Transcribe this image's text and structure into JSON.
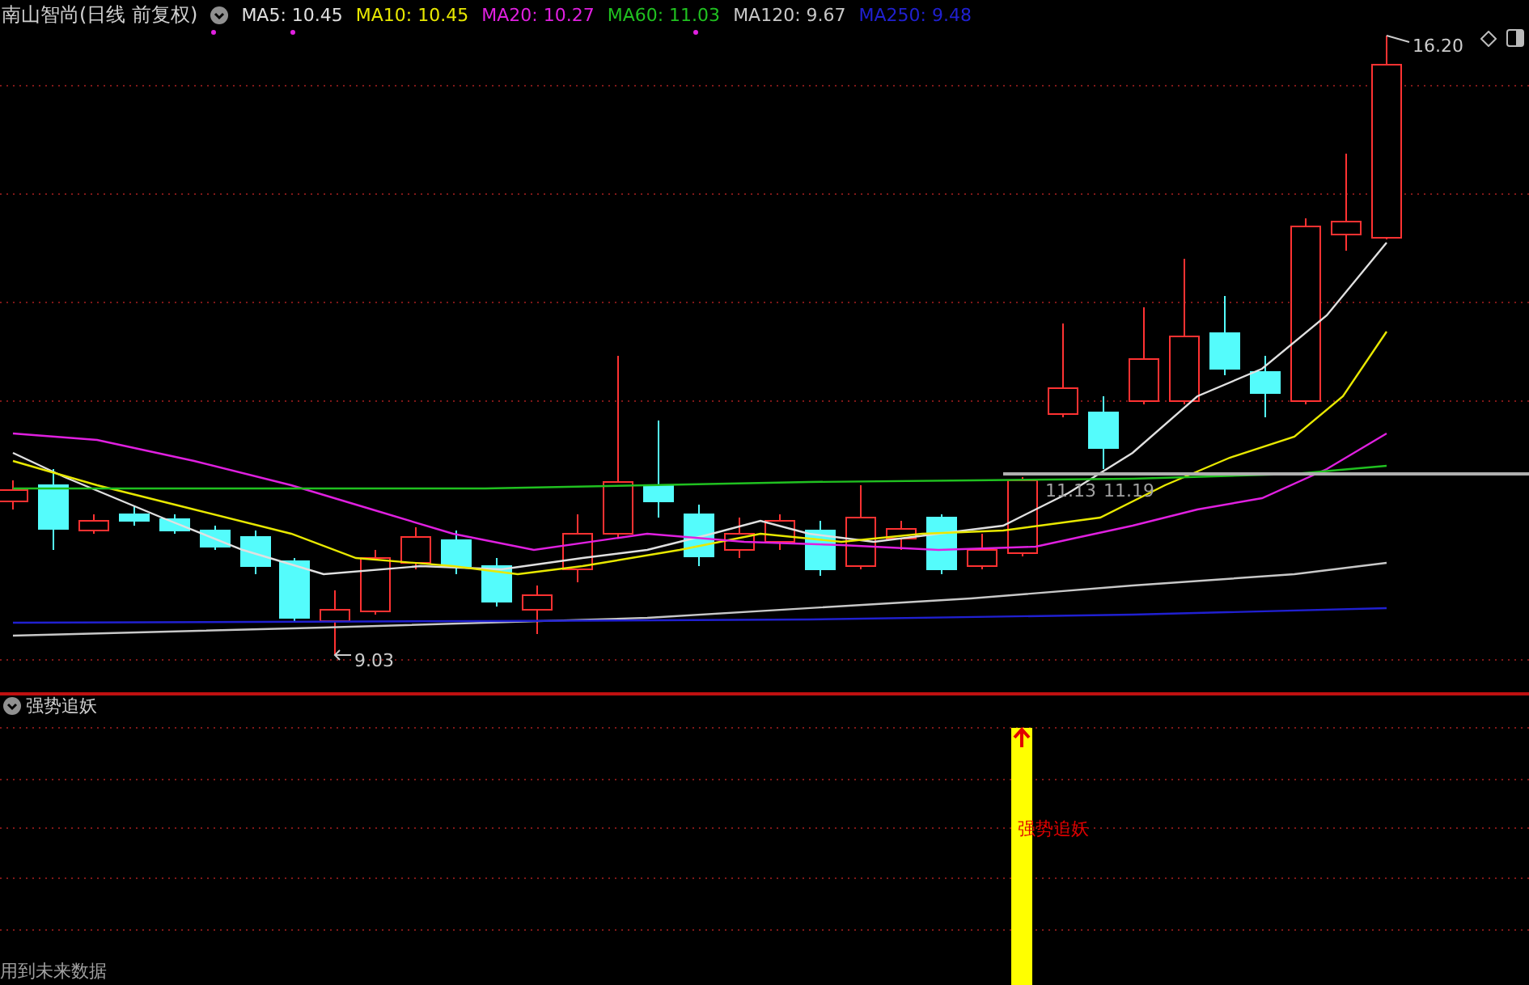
{
  "header": {
    "title": "南山智尚(日线 前复权)",
    "ma_items": [
      {
        "label": "MA5: 10.45",
        "color": "#e0e0e0"
      },
      {
        "label": "MA10: 10.45",
        "color": "#e8e800"
      },
      {
        "label": "MA20: 10.27",
        "color": "#e020e0"
      },
      {
        "label": "MA60: 11.03",
        "color": "#20c020"
      },
      {
        "label": "MA120: 9.67",
        "color": "#c8c8c8"
      },
      {
        "label": "MA250: 9.48",
        "color": "#2020d0"
      }
    ]
  },
  "main_chart": {
    "price_labels": [
      {
        "kind": "high",
        "text": "16.20"
      },
      {
        "kind": "low",
        "text": "9.03"
      },
      {
        "kind": "level",
        "text": "11.13"
      },
      {
        "kind": "level",
        "text": "11.19"
      }
    ]
  },
  "indicator": {
    "title": "强势追妖",
    "signal_label": "强势追妖",
    "footer": "用到未来数据"
  }
}
